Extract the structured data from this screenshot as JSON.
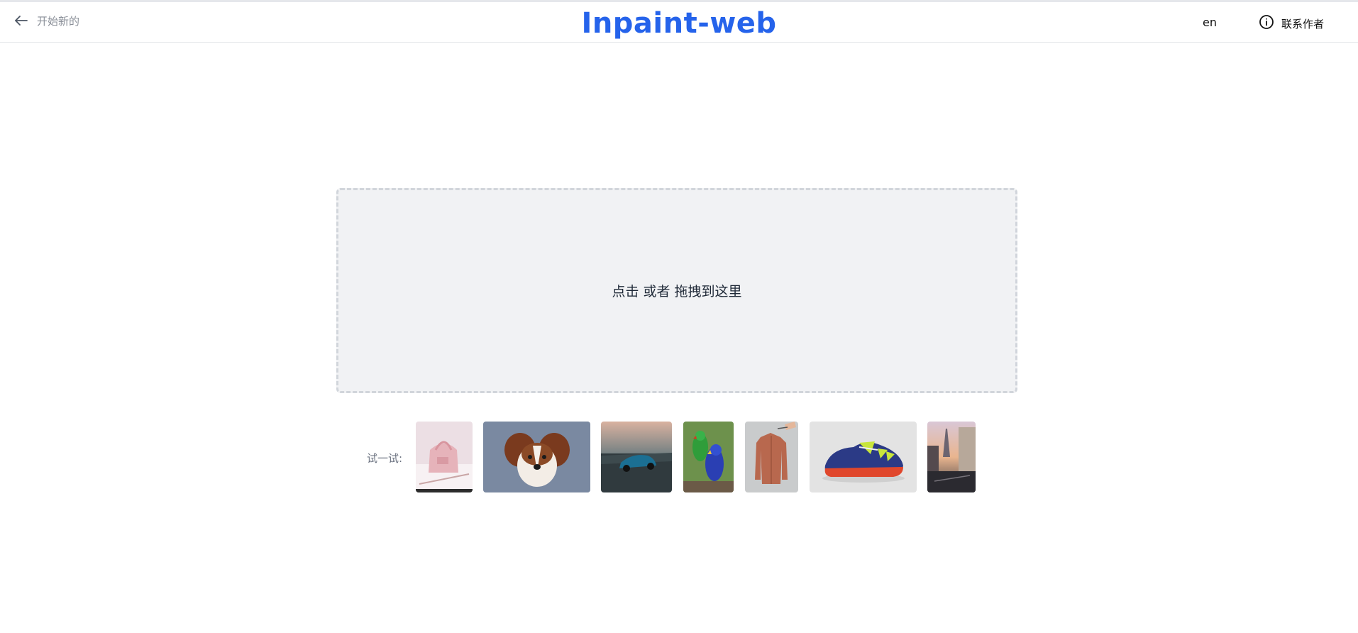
{
  "header": {
    "back_label": "开始新的",
    "title": "Inpaint-web",
    "lang_label": "en",
    "contact_label": "联系作者"
  },
  "icons": {
    "back": "arrow-left-icon",
    "contact": "info-circle-icon"
  },
  "dropzone": {
    "text": "点击 或者 拖拽到这里"
  },
  "samples": {
    "label": "试一试:",
    "items": [
      "bag",
      "dog",
      "car",
      "parrots",
      "jacket",
      "shoe",
      "paris"
    ]
  },
  "colors": {
    "accent": "#2563eb",
    "dropzone_bg": "#f1f2f4",
    "dropzone_border": "#d1d5db"
  }
}
